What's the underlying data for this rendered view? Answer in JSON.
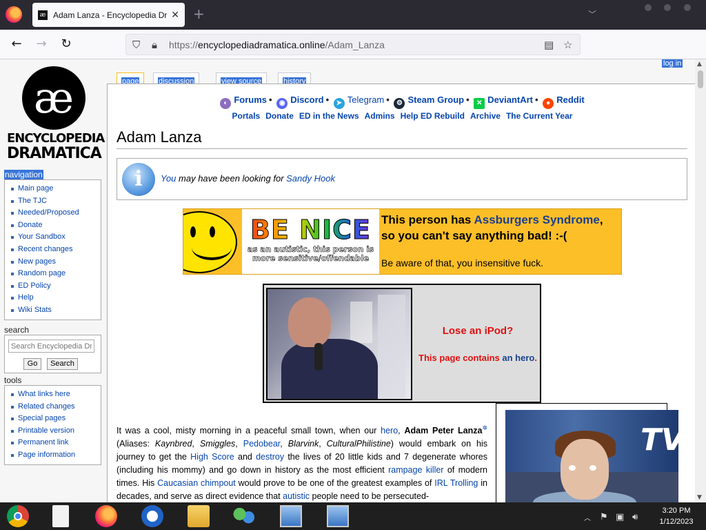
{
  "browser": {
    "tab_title": "Adam Lanza - Encyclopedia Dram",
    "tab_favicon": "æ",
    "url_prefix": "https://",
    "url_domain": "encyclopediadramatica.online",
    "url_path": "/Adam_Lanza",
    "new_tab": "+",
    "icons": [
      "firefox-icon",
      "back-icon",
      "forward-icon",
      "reload-icon",
      "shield-icon",
      "lock-icon",
      "reader-view-icon",
      "bookmark-star-icon",
      "pocket-icon",
      "download-icon",
      "menu-icon"
    ]
  },
  "page": {
    "logo_line1": "ENCYCLOPEDIA",
    "logo_line2": "DRAMATICA",
    "tabs": [
      {
        "label": "page"
      },
      {
        "label": "discussion"
      },
      {
        "label": "view source"
      },
      {
        "label": "history"
      }
    ],
    "login": "log in",
    "sidebar": {
      "navigation_heading": "navigation",
      "navigation": [
        "Main page",
        "The TJC",
        "Needed/Proposed",
        "Donate",
        "Your Sandbox",
        "Recent changes",
        "New pages",
        "Random page",
        "ED Policy",
        "Help",
        "Wiki Stats"
      ],
      "search_heading": "search",
      "search_placeholder": "Search Encyclopedia Dra",
      "go_button": "Go",
      "search_button": "Search",
      "tools_heading": "tools",
      "tools": [
        "What links here",
        "Related changes",
        "Special pages",
        "Printable version",
        "Permanent link",
        "Page information"
      ]
    },
    "top_links": {
      "forums": "Forums",
      "discord": "Discord",
      "telegram": "Telegram",
      "steam": "Steam Group",
      "deviantart": "DeviantArt",
      "reddit": "Reddit",
      "sep": "•"
    },
    "sub_links": [
      "Portals",
      "Donate",
      "ED in the News",
      "Admins",
      "Help ED Rebuild",
      "Archive",
      "The Current Year"
    ],
    "title": "Adam Lanza",
    "notice": {
      "you": "You",
      "text": " may have been looking for ",
      "link": "Sandy Hook"
    },
    "be_nice": {
      "big": "BE NICE",
      "small": "as an autistic, this person is more sensitive/offendable",
      "line1_a": "This person has ",
      "line1_link": "Assburgers Syndrome",
      "line1_b": ",",
      "line2": "so you can't say anything bad! :-(",
      "sub": "Be aware of that, you insensitive fuck."
    },
    "hero": {
      "title": "Lose an iPod?",
      "text_a": "This page contains ",
      "link": "an hero",
      "text_b": "."
    },
    "photo_caption_visible": "TV",
    "article": {
      "p1_a": "It was a cool, misty morning in a peaceful small town, when our ",
      "hero": "hero",
      "p1_b": ", ",
      "name": "Adam Peter Lanza",
      "p1_c": " (Aliases: ",
      "alias1": "Kaynbred",
      "alias2": "Smiggles",
      "alias3": "Pedobear",
      "alias4": "Blarvink",
      "alias5": "CulturalPhilistine",
      "p1_d": ") would embark on his journey to get the ",
      "highscore": "High Score",
      "p1_e": " and ",
      "destroy": "destroy",
      "p1_f": " the lives of 20 little kids and 7 degenerate whores (including his mommy) and go down in history as the most efficient ",
      "rampage": "rampage killer",
      "p1_g": " of modern times. His ",
      "caucasian": "Caucasian",
      "chimpout": "chimpout",
      "p1_h": " would prove to be one of the greatest examples of ",
      "irl": "IRL Trolling",
      "p1_i": " in decades, and serve as direct evidence that ",
      "autistic": "autistic",
      "p1_j": " people need to be persecuted-"
    }
  },
  "taskbar": {
    "items": [
      "chrome-icon",
      "file-icon",
      "firefox-icon",
      "opera-icon",
      "file-explorer-icon",
      "network-users-icon",
      "remote-desktop-icon",
      "remote-desktop-icon-2"
    ],
    "time": "3:20 PM",
    "date": "1/12/2023"
  }
}
